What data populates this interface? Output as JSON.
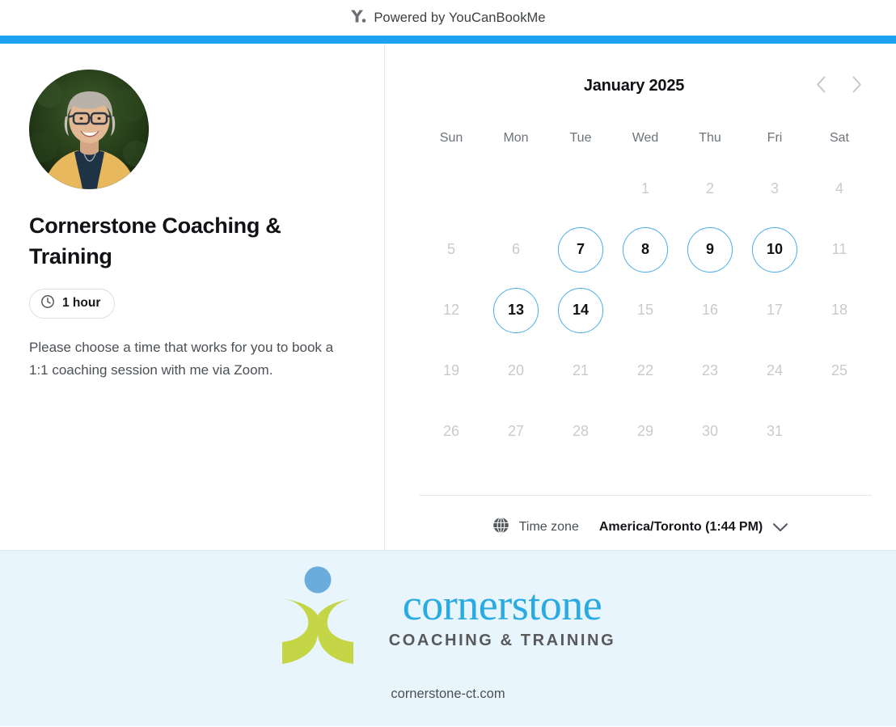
{
  "header": {
    "powered_text": "Powered by YouCanBookMe",
    "logo_icon": "ycbm-y-logo-icon",
    "accent_color": "#1da2f2"
  },
  "profile": {
    "avatar_icon": "avatar-photo",
    "title": "Cornerstone Coaching & Training",
    "duration_icon": "clock-icon",
    "duration": "1 hour",
    "description": "Please choose a time that works for you to book a 1:1 coaching session with me via Zoom."
  },
  "calendar": {
    "month_label": "January 2025",
    "prev_icon": "chevron-left-icon",
    "next_icon": "chevron-right-icon",
    "weekdays": [
      "Sun",
      "Mon",
      "Tue",
      "Wed",
      "Thu",
      "Fri",
      "Sat"
    ],
    "leading_blanks": 3,
    "days": [
      {
        "n": "1",
        "available": false
      },
      {
        "n": "2",
        "available": false
      },
      {
        "n": "3",
        "available": false
      },
      {
        "n": "4",
        "available": false
      },
      {
        "n": "5",
        "available": false
      },
      {
        "n": "6",
        "available": false
      },
      {
        "n": "7",
        "available": true
      },
      {
        "n": "8",
        "available": true
      },
      {
        "n": "9",
        "available": true
      },
      {
        "n": "10",
        "available": true
      },
      {
        "n": "11",
        "available": false
      },
      {
        "n": "12",
        "available": false
      },
      {
        "n": "13",
        "available": true
      },
      {
        "n": "14",
        "available": true
      },
      {
        "n": "15",
        "available": false
      },
      {
        "n": "16",
        "available": false
      },
      {
        "n": "17",
        "available": false
      },
      {
        "n": "18",
        "available": false
      },
      {
        "n": "19",
        "available": false
      },
      {
        "n": "20",
        "available": false
      },
      {
        "n": "21",
        "available": false
      },
      {
        "n": "22",
        "available": false
      },
      {
        "n": "23",
        "available": false
      },
      {
        "n": "24",
        "available": false
      },
      {
        "n": "25",
        "available": false
      },
      {
        "n": "26",
        "available": false
      },
      {
        "n": "27",
        "available": false
      },
      {
        "n": "28",
        "available": false
      },
      {
        "n": "29",
        "available": false
      },
      {
        "n": "30",
        "available": false
      },
      {
        "n": "31",
        "available": false
      }
    ],
    "available_highlight_color": "#4aade9"
  },
  "timezone": {
    "globe_icon": "globe-icon",
    "label": "Time zone",
    "value": "America/Toronto (1:44 PM)",
    "caret_icon": "chevron-down-icon"
  },
  "footer": {
    "background_color": "#e9f5fc",
    "logo_icon": "cornerstone-person-logo-icon",
    "brand_name": "cornerstone",
    "brand_tagline": "COACHING & TRAINING",
    "brand_color": "#29abe2",
    "mark_green": "#c4d646",
    "mark_blue": "#6bacdc",
    "url": "cornerstone-ct.com"
  }
}
